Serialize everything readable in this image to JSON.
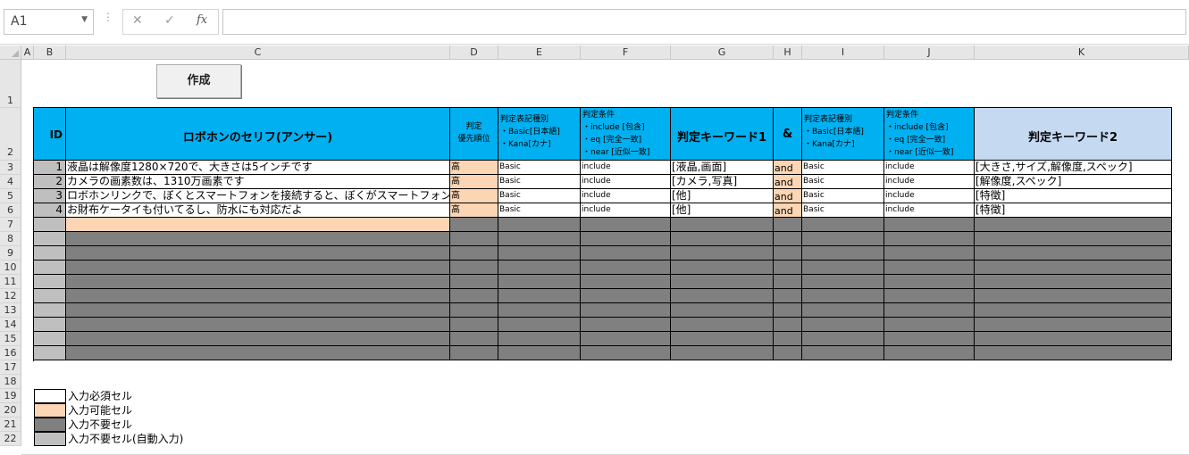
{
  "formula_bar": {
    "name_box": "A1",
    "cancel_icon": "✕",
    "enter_icon": "✓",
    "fx_label": "fx",
    "formula": ""
  },
  "columns": [
    "A",
    "B",
    "C",
    "D",
    "E",
    "F",
    "G",
    "H",
    "I",
    "J",
    "K"
  ],
  "rows": [
    "1",
    "2",
    "3",
    "4",
    "5",
    "6",
    "7",
    "8",
    "9",
    "10",
    "11",
    "12",
    "13",
    "14",
    "15",
    "16",
    "17",
    "18",
    "19",
    "20",
    "21",
    "22"
  ],
  "create_button": "作成",
  "table": {
    "headers": {
      "id": "ID",
      "answer": "ロボホンのセリフ(アンサー)",
      "priority": "判定\n優先順位",
      "notation1": "判定表記種別\n・Basic[日本語]\n・Kana[カナ]",
      "condition1": "判定条件\n・include [包含]\n・eq [完全一致]\n・near [近似一致]",
      "keyword1": "判定キーワード1",
      "amp": "&",
      "notation2": "判定表記種別\n・Basic[日本語]\n・Kana[カナ]",
      "condition2": "判定条件\n・include [包含]\n・eq [完全一致]\n・near [近似一致]",
      "keyword2": "判定キーワード2"
    },
    "rows": [
      {
        "id": "1",
        "answer": "液晶は解像度1280×720で、大きさは5インチです",
        "priority": "高",
        "notation1": "Basic",
        "condition1": "include",
        "keyword1": "[液晶,画面]",
        "amp": "and",
        "notation2": "Basic",
        "condition2": "include",
        "keyword2": "[大きさ,サイズ,解像度,スペック]"
      },
      {
        "id": "2",
        "answer": "カメラの画素数は、1310万画素です",
        "priority": "高",
        "notation1": "Basic",
        "condition1": "include",
        "keyword1": "[カメラ,写真]",
        "amp": "and",
        "notation2": "Basic",
        "condition2": "include",
        "keyword2": "[解像度,スペック]"
      },
      {
        "id": "3",
        "answer": "ロボホンリンクで、ぼくとスマートフォンを接続すると、ぼくがスマートフォンに来て",
        "priority": "高",
        "notation1": "Basic",
        "condition1": "include",
        "keyword1": "[他]",
        "amp": "and",
        "notation2": "Basic",
        "condition2": "include",
        "keyword2": "[特徴]"
      },
      {
        "id": "4",
        "answer": "お財布ケータイも付いてるし、防水にも対応だよ",
        "priority": "高",
        "notation1": "Basic",
        "condition1": "include",
        "keyword1": "[他]",
        "amp": "and",
        "notation2": "Basic",
        "condition2": "include",
        "keyword2": "[特徴]"
      }
    ]
  },
  "legend": [
    {
      "label": "入力必須セル",
      "color": "#ffffff"
    },
    {
      "label": "入力可能セル",
      "color": "#fcd5b4"
    },
    {
      "label": "入力不要セル",
      "color": "#808080"
    },
    {
      "label": "入力不要セル(自動入力)",
      "color": "#bfbfbf"
    }
  ]
}
